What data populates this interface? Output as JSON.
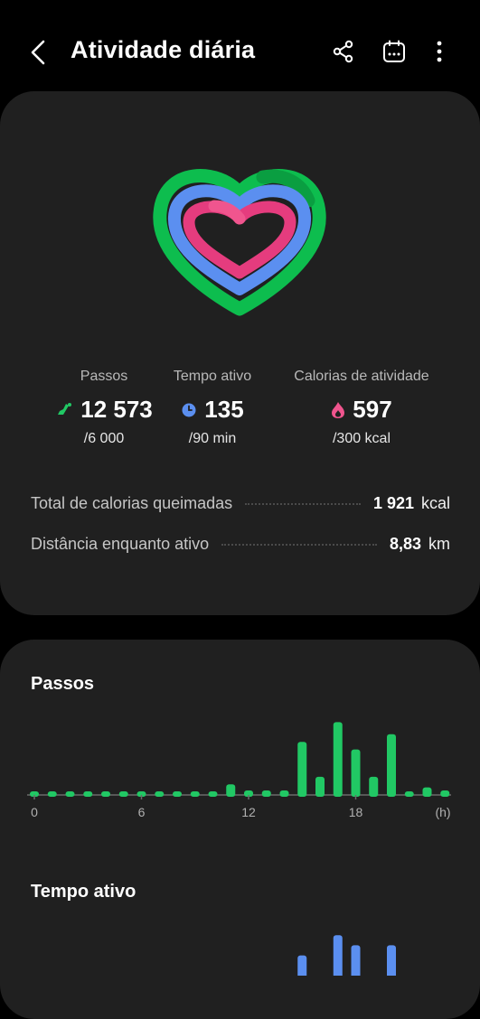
{
  "header": {
    "title": "Atividade diária",
    "icons": [
      "back-icon",
      "share-icon",
      "calendar-icon",
      "more-icon"
    ]
  },
  "summary": {
    "ring_colors": {
      "steps": "#21c864",
      "active": "#5b8ff0",
      "calories": "#e53c7e"
    },
    "stats": [
      {
        "label": "Passos",
        "value": "12 573",
        "goal": "/6 000",
        "icon": "steps-icon",
        "color": "#21c864"
      },
      {
        "label": "Tempo ativo",
        "value": "135",
        "goal": "/90 min",
        "icon": "clock-icon",
        "color": "#5b8ff0"
      },
      {
        "label": "Calorias de atividade",
        "value": "597",
        "goal": "/300 kcal",
        "icon": "flame-icon",
        "color": "#f0558e"
      }
    ],
    "rows": [
      {
        "label": "Total de calorias queimadas",
        "value": "1 921",
        "unit": "kcal"
      },
      {
        "label": "Distância enquanto ativo",
        "value": "8,83",
        "unit": "km"
      }
    ]
  },
  "steps_section": {
    "title": "Passos",
    "chart_data": {
      "type": "bar",
      "x": [
        0,
        1,
        2,
        3,
        4,
        5,
        6,
        7,
        8,
        9,
        10,
        11,
        12,
        13,
        14,
        15,
        16,
        17,
        18,
        19,
        20,
        21,
        22,
        23
      ],
      "values": [
        2,
        0,
        0,
        0,
        0,
        0,
        0,
        0,
        2,
        0,
        0,
        7,
        3,
        3,
        3,
        35,
        12,
        48,
        30,
        12,
        40,
        2,
        5,
        3
      ],
      "ylim": [
        0,
        50
      ],
      "x_ticks": [
        "0",
        "6",
        "12",
        "18"
      ],
      "x_unit": "(h)",
      "color": "#21c864"
    }
  },
  "active_section": {
    "title": "Tempo ativo",
    "chart_data": {
      "type": "bar",
      "x": [
        15,
        17,
        18,
        20
      ],
      "values": [
        40,
        80,
        60,
        60
      ],
      "color": "#5b8ff0"
    }
  }
}
